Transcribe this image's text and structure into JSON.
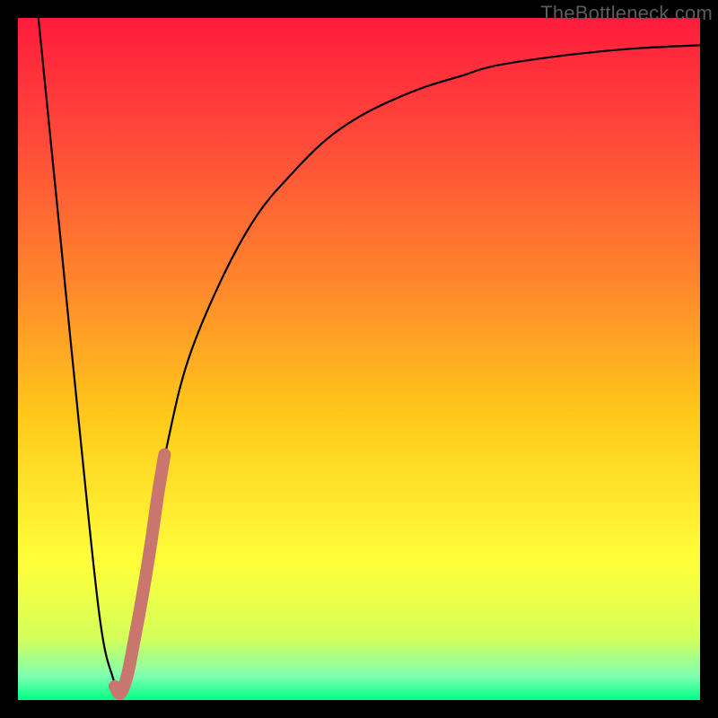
{
  "watermark": "TheBottleneck.com",
  "colors": {
    "frame": "#000000",
    "curve": "#000000",
    "highlight": "#c9766f",
    "gradient_stops": [
      {
        "offset": 0.0,
        "color": "#ff1c3c"
      },
      {
        "offset": 0.18,
        "color": "#ff4a3a"
      },
      {
        "offset": 0.4,
        "color": "#ff8a2b"
      },
      {
        "offset": 0.58,
        "color": "#ffc81a"
      },
      {
        "offset": 0.8,
        "color": "#ffff3a"
      },
      {
        "offset": 0.91,
        "color": "#d4ff5a"
      },
      {
        "offset": 0.965,
        "color": "#7fffb0"
      },
      {
        "offset": 1.0,
        "color": "#00ff88"
      }
    ]
  },
  "chart_data": {
    "type": "line",
    "title": "",
    "xlabel": "",
    "ylabel": "",
    "xlim": [
      0,
      100
    ],
    "ylim": [
      0,
      100
    ],
    "series": [
      {
        "name": "bottleneck-curve",
        "x": [
          3,
          6,
          9,
          12,
          14,
          15,
          16,
          18,
          20,
          22,
          25,
          30,
          35,
          40,
          45,
          50,
          55,
          60,
          65,
          70,
          80,
          90,
          100
        ],
        "y": [
          100,
          70,
          40,
          12,
          3,
          1,
          4,
          14,
          27,
          38,
          50,
          62,
          71,
          77,
          82,
          85.5,
          88,
          90,
          91.5,
          93,
          94.5,
          95.5,
          96
        ]
      },
      {
        "name": "highlight-segment",
        "x": [
          14.2,
          15.0,
          16.0,
          17.0,
          18.2,
          19.5,
          20.5,
          21.5
        ],
        "y": [
          2.0,
          1.0,
          3.5,
          8.5,
          15.0,
          23.0,
          30.0,
          36.0
        ]
      }
    ]
  }
}
